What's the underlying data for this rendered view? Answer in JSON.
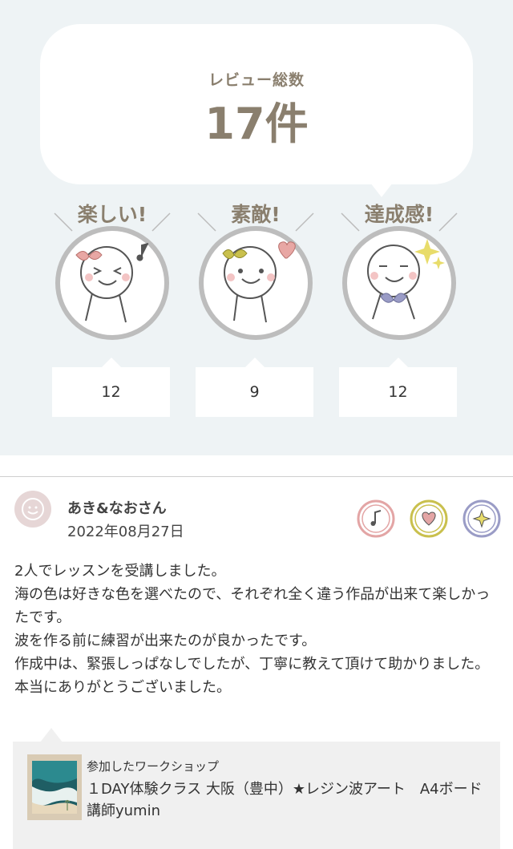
{
  "summary": {
    "total_label": "レビュー総数",
    "total_count": "17件",
    "categories": [
      {
        "title": "楽しい!",
        "count": "12",
        "face": "fun-face-icon",
        "accent": "#e8a7a4"
      },
      {
        "title": "素敵!",
        "count": "9",
        "face": "nice-face-icon",
        "accent": "#c9c04d"
      },
      {
        "title": "達成感!",
        "count": "12",
        "face": "achievement-face-icon",
        "accent": "#9a9cc6"
      }
    ]
  },
  "review": {
    "reviewer": "あき&なおさん",
    "date": "2022年08月27日",
    "badges": [
      "music-note-icon",
      "heart-icon",
      "sparkle-icon"
    ],
    "badge_colors": [
      "#e3a5a5",
      "#c9c04d",
      "#9a9cc6"
    ],
    "lines": [
      "2人でレッスンを受講しました。",
      "海の色は好きな色を選べたので、それぞれ全く違う作品が出来て楽しかったです。",
      "波を作る前に練習が出来たのが良かったです。",
      "作成中は、緊張しっぱなしでしたが、丁寧に教えて頂けて助かりました。",
      "本当にありがとうございました。"
    ]
  },
  "workshop": {
    "label": "参加したワークショップ",
    "title": "１DAY体験クラス 大阪（豊中）★レジン波アート　A4ボード　講師yumin"
  }
}
